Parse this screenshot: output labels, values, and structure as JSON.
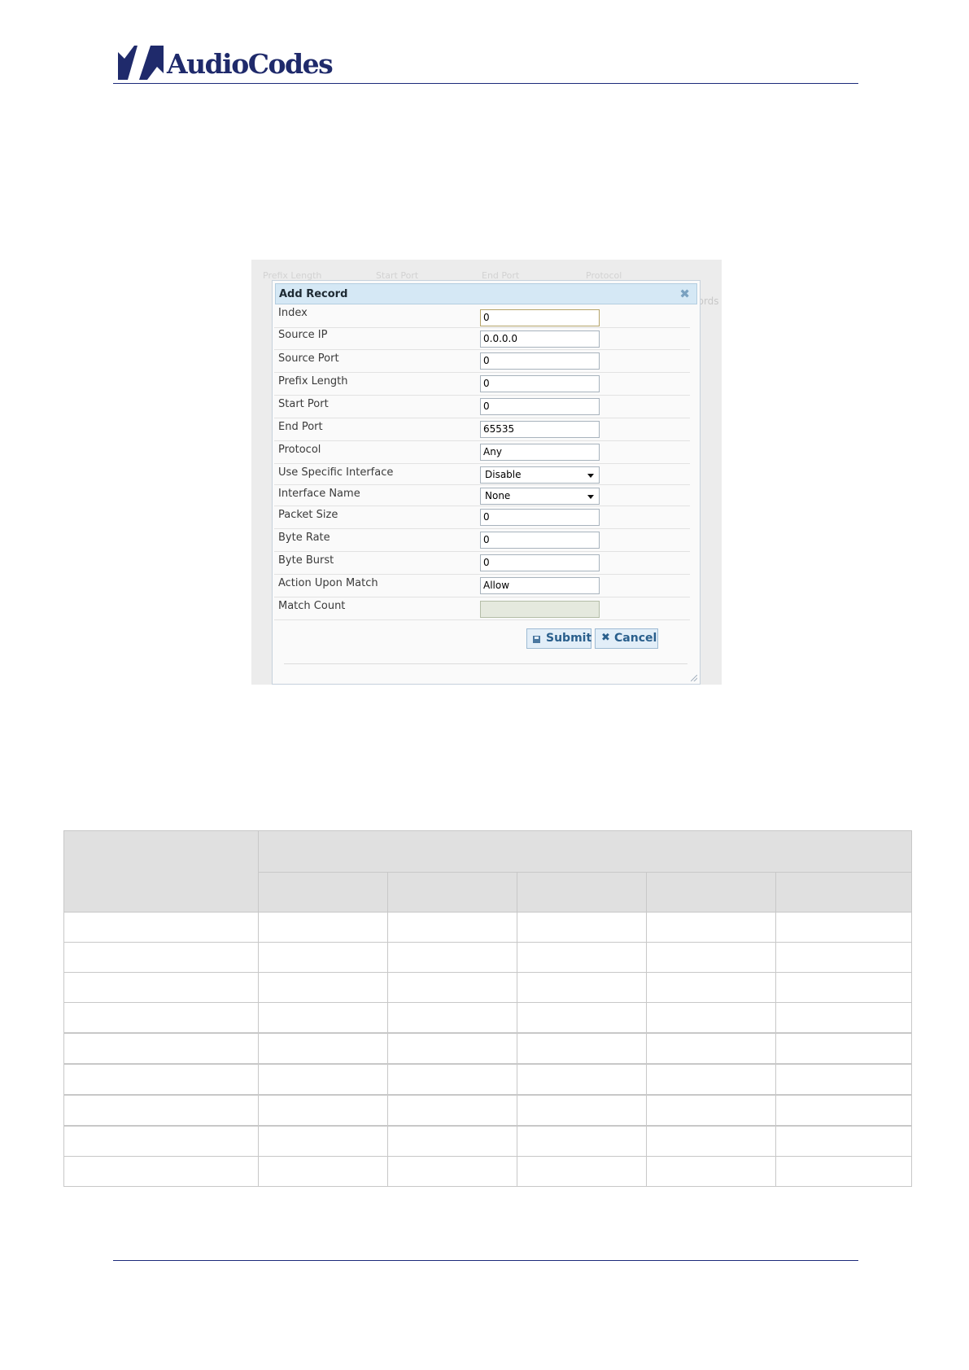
{
  "header": {
    "logo_text": "AudioCodes",
    "brand_color": "#1f2a6b",
    "rule_color": "#1c2a7a"
  },
  "screenshot": {
    "background_fragments": {
      "headers": [
        "Prefix Length",
        "Start Port",
        "End Port",
        "Protocol"
      ],
      "side": "cords"
    },
    "dialog": {
      "title": "Add Record",
      "close_icon": "close-icon",
      "rows": [
        {
          "label": "Index",
          "value": "0",
          "kind": "text",
          "state": "focused"
        },
        {
          "label": "Source IP",
          "value": "0.0.0.0",
          "kind": "text"
        },
        {
          "label": "Source Port",
          "value": "0",
          "kind": "text"
        },
        {
          "label": "Prefix Length",
          "value": "0",
          "kind": "text"
        },
        {
          "label": "Start Port",
          "value": "0",
          "kind": "text"
        },
        {
          "label": "End Port",
          "value": "65535",
          "kind": "text"
        },
        {
          "label": "Protocol",
          "value": "Any",
          "kind": "text"
        },
        {
          "label": "Use Specific Interface",
          "value": "Disable",
          "kind": "select"
        },
        {
          "label": "Interface Name",
          "value": "None",
          "kind": "select"
        },
        {
          "label": "Packet Size",
          "value": "0",
          "kind": "text"
        },
        {
          "label": "Byte Rate",
          "value": "0",
          "kind": "text"
        },
        {
          "label": "Byte Burst",
          "value": "0",
          "kind": "text"
        },
        {
          "label": "Action Upon Match",
          "value": "Allow",
          "kind": "text"
        },
        {
          "label": "Match Count",
          "value": "",
          "kind": "readonly"
        }
      ],
      "buttons": {
        "submit": {
          "label": "Submit",
          "icon": "save-icon"
        },
        "cancel": {
          "label": "Cancel",
          "icon": "close-icon"
        }
      }
    }
  },
  "table": {
    "header_color": "#e0e0e0",
    "body_rows": [
      [
        "",
        "",
        "",
        "",
        "",
        ""
      ],
      [
        "",
        "",
        "",
        "",
        "",
        ""
      ],
      [
        "",
        "",
        "",
        "",
        "",
        ""
      ],
      [
        "",
        "",
        "",
        "",
        "",
        ""
      ],
      [
        "",
        "",
        "",
        "",
        "",
        ""
      ],
      [
        "",
        "",
        "",
        "",
        "",
        ""
      ],
      [
        "",
        "",
        "",
        "",
        "",
        ""
      ],
      [
        "",
        "",
        "",
        "",
        "",
        ""
      ],
      [
        "",
        "",
        "",
        "",
        "",
        ""
      ]
    ]
  }
}
